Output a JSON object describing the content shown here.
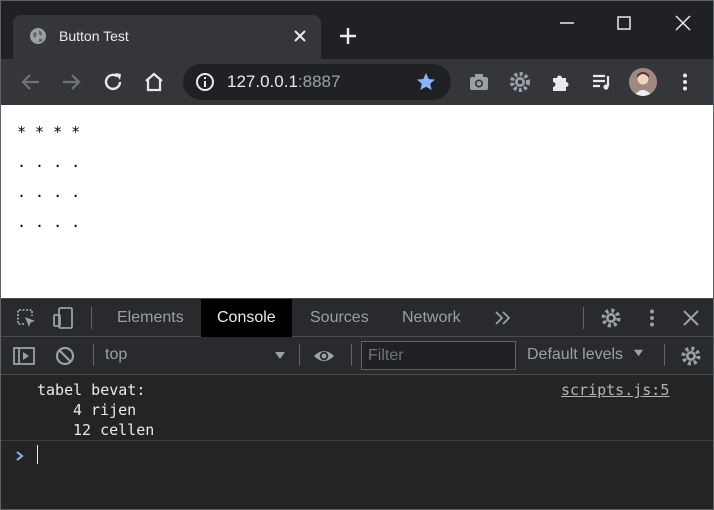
{
  "window": {
    "tab_title": "Button Test"
  },
  "toolbar": {
    "url_host": "127.0.0.1",
    "url_port": ":8887"
  },
  "page": {
    "rows": [
      "* * * *",
      ". . . .",
      ". . . .",
      ". . . ."
    ]
  },
  "devtools": {
    "tabs": [
      "Elements",
      "Console",
      "Sources",
      "Network"
    ],
    "active_tab": "Console",
    "context": "top",
    "filter_placeholder": "Filter",
    "levels": "Default levels",
    "log": {
      "lines": [
        "tabel bevat:",
        "4 rijen",
        "12 cellen"
      ],
      "source": "scripts.js:5"
    }
  },
  "colors": {
    "bookmark_star": "#8ab4f8",
    "prompt": "#8ab4f8",
    "icon": "#9aa0a6"
  }
}
